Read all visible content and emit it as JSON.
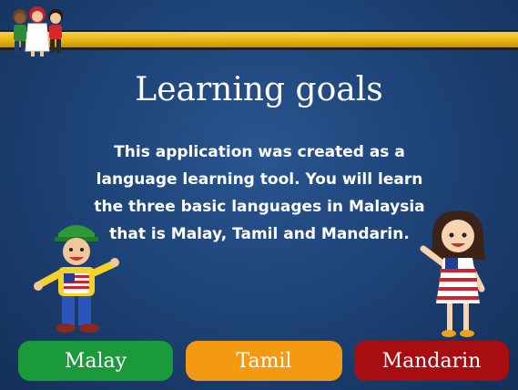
{
  "page": {
    "title": "Learning goals",
    "description": "This application was created as a language learning tool. You will learn the three basic languages in Malaysia that is Malay, Tamil and Mandarin."
  },
  "icons": {
    "logo": "kids-group-icon",
    "boy": "boy-character-icon",
    "girl": "girl-character-icon"
  },
  "buttons": {
    "malay": "Malay",
    "tamil": "Tamil",
    "mandarin": "Mandarin"
  },
  "colors": {
    "background": "#1e4478",
    "top_bar": "#e7b414",
    "malay": "#1a9a3a",
    "tamil": "#f39a12",
    "mandarin": "#a80d12"
  }
}
